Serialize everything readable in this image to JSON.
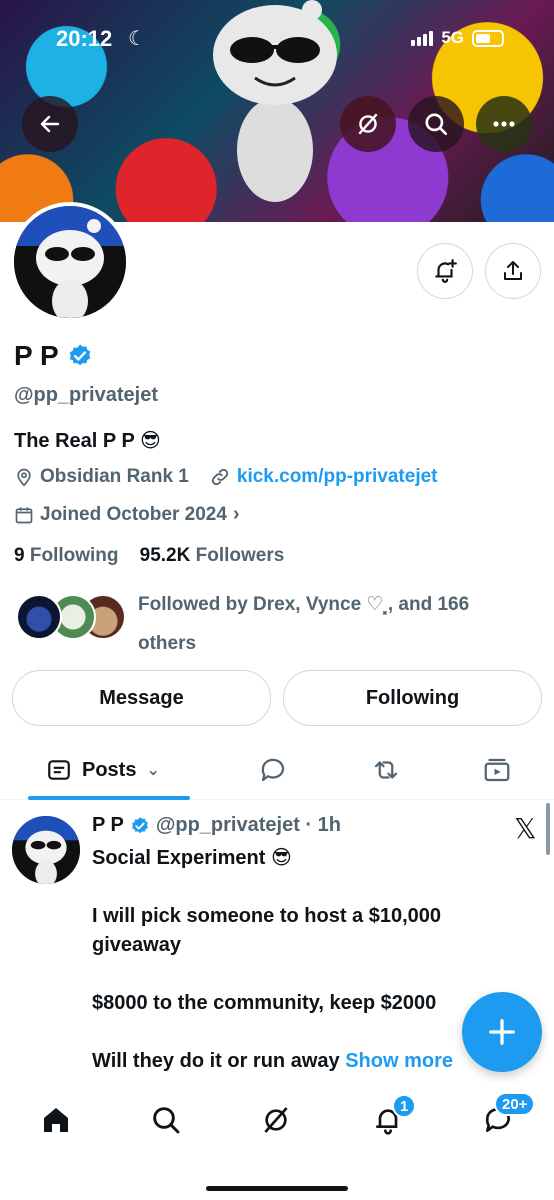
{
  "status_bar": {
    "time": "20:12",
    "network": "5G"
  },
  "profile": {
    "display_name": "P P",
    "handle": "@pp_privatejet",
    "bio": "The Real P P 😎",
    "location": "Obsidian Rank 1",
    "website": "kick.com/pp-privatejet",
    "joined": "Joined October 2024",
    "following_count": "9",
    "following_label": "Following",
    "followers_count": "95.2K",
    "followers_label": "Followers",
    "followed_by": "Followed by Drex, Vynce ♡⸼, and 166 others"
  },
  "actions": {
    "message_label": "Message",
    "following_label": "Following"
  },
  "tabs": {
    "posts_label": "Posts"
  },
  "tweet": {
    "name": "P P",
    "handle_time": "@pp_privatejet · 1h",
    "lines": [
      "Social Experiment 😎",
      "",
      "I will pick someone to host a $10,000",
      "giveaway",
      "",
      "$8000 to the community, keep $2000",
      "",
      "Will they do it or run away"
    ],
    "show_more": "Show more"
  },
  "nav": {
    "notifications_badge": "1",
    "messages_badge": "20+"
  },
  "colors": {
    "accent": "#1d9bf0",
    "text": "#0f1419",
    "muted": "#536471"
  }
}
